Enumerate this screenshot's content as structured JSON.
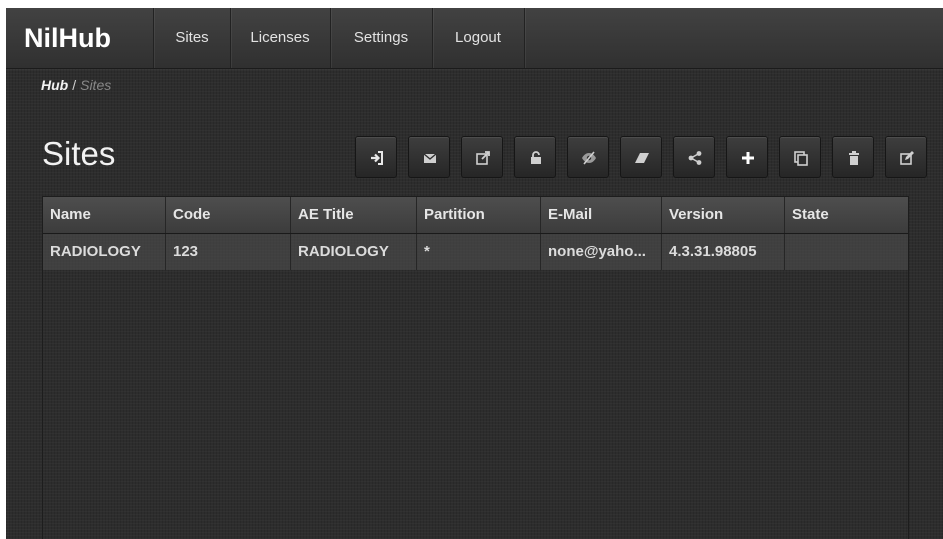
{
  "app": {
    "brand": "NilHub"
  },
  "nav": {
    "items": [
      {
        "label": "Sites"
      },
      {
        "label": "Licenses"
      },
      {
        "label": "Settings"
      },
      {
        "label": "Logout"
      }
    ]
  },
  "breadcrumb": {
    "root": "Hub",
    "separator": "/",
    "current": "Sites"
  },
  "page": {
    "title": "Sites"
  },
  "toolbar": {
    "buttons": [
      {
        "icon": "sign-in-icon"
      },
      {
        "icon": "envelope-icon"
      },
      {
        "icon": "external-link-icon"
      },
      {
        "icon": "unlock-icon"
      },
      {
        "icon": "eye-slash-icon"
      },
      {
        "icon": "eraser-icon"
      },
      {
        "icon": "share-icon"
      },
      {
        "icon": "plus-icon"
      },
      {
        "icon": "copy-icon"
      },
      {
        "icon": "trash-icon"
      },
      {
        "icon": "edit-icon"
      }
    ]
  },
  "table": {
    "columns": [
      "Name",
      "Code",
      "AE Title",
      "Partition",
      "E-Mail",
      "Version",
      "State"
    ],
    "rows": [
      [
        "RADIOLOGY",
        "123",
        "RADIOLOGY",
        "*",
        "none@yaho...",
        "4.3.31.98805",
        ""
      ]
    ]
  },
  "colors": {
    "background": "#2d2d2d",
    "navbar": "#3a3a3a",
    "text": "#e2e2e2",
    "muted": "#888888"
  }
}
